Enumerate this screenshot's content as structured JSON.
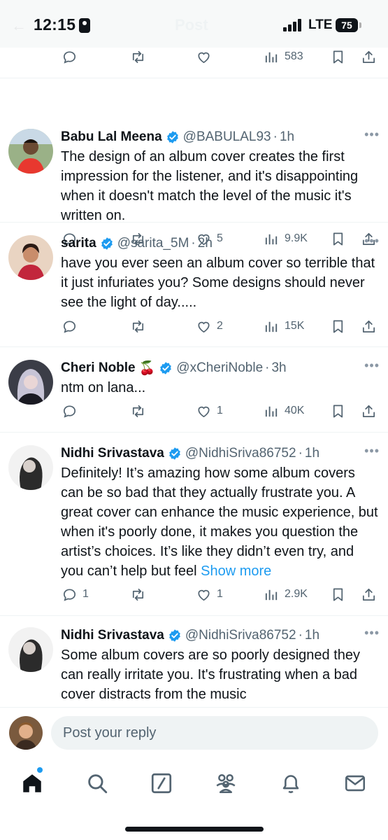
{
  "status_bar": {
    "time": "12:15",
    "network": "LTE",
    "battery": "75",
    "screen_title": "Post"
  },
  "top_actions": {
    "views": "583"
  },
  "posts": [
    {
      "name": "Babu Lal Meena",
      "handle": "@BABULAL93",
      "time": "1h",
      "text": "The design of an album cover creates the first impression for the listener, and it's disappointing when it doesn't match the level of the music it's written on.",
      "replies": "",
      "reposts": "",
      "likes": "5",
      "views": "9.9K"
    },
    {
      "name": "sarita",
      "handle": "@sarita_5M",
      "time": "2h",
      "text": "have you ever seen an album cover so terrible that it just infuriates you? Some designs should never see the light of day.....",
      "replies": "",
      "reposts": "",
      "likes": "2",
      "views": "15K"
    },
    {
      "name": "Cheri Noble",
      "name_emoji": "🍒",
      "handle": "@xCheriNoble",
      "time": "3h",
      "text": "ntm on lana...",
      "replies": "",
      "reposts": "",
      "likes": "1",
      "views": "40K"
    },
    {
      "name": "Nidhi Srivastava",
      "handle": "@NidhiSriva86752",
      "time": "1h",
      "text": "Definitely! It’s amazing how some album covers can be so bad that they actually frustrate you. A great cover can enhance the music experience, but when it's poorly done, it makes you question the artist’s choices. It’s like they didn’t even try, and you can’t help but feel",
      "show_more": "Show more",
      "replies": "1",
      "reposts": "",
      "likes": "1",
      "views": "2.9K"
    },
    {
      "name": "Nidhi Srivastava",
      "handle": "@NidhiSriva86752",
      "time": "1h",
      "text": "Some album covers are so poorly designed they can really irritate you. It's frustrating when a bad cover distracts from the music"
    }
  ],
  "reply": {
    "placeholder": "Post your reply"
  },
  "tabs": [
    "home-icon",
    "search-icon",
    "grok-icon",
    "communities-icon",
    "notifications-icon",
    "messages-icon"
  ],
  "colors": {
    "accent": "#1d9bf0",
    "text": "#0f1419",
    "secondary": "#536471",
    "divider": "#eff3f4"
  }
}
